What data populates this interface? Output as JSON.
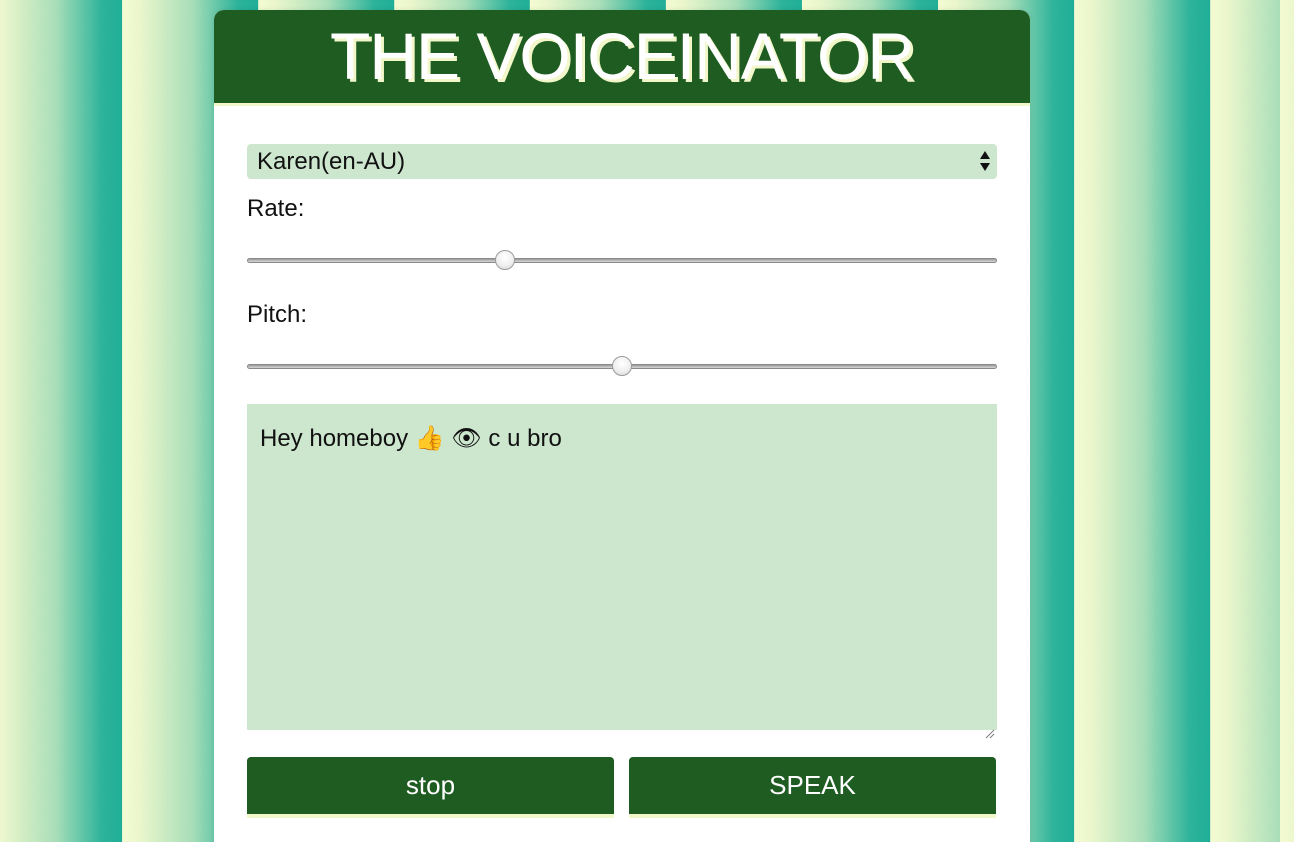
{
  "app": {
    "title": "THE VOICEINATOR"
  },
  "voice_select": {
    "selected": "Karen(en-AU)"
  },
  "rate": {
    "label": "Rate:",
    "value_fraction": 0.34
  },
  "pitch": {
    "label": "Pitch:",
    "value_fraction": 0.5
  },
  "message": {
    "text": "Hey homeboy 👍 👁 c u bro"
  },
  "buttons": {
    "stop_label": "stop",
    "speak_label": "SPEAK"
  },
  "colors": {
    "header_bg": "#1f5c22",
    "field_bg": "#cde6ce",
    "accent_cream": "#f2f7c9",
    "stripe_teal": "#20ae98"
  },
  "icons": {
    "select_arrows": "updown-arrows-icon",
    "textarea_resize": "resize-handle-icon"
  }
}
